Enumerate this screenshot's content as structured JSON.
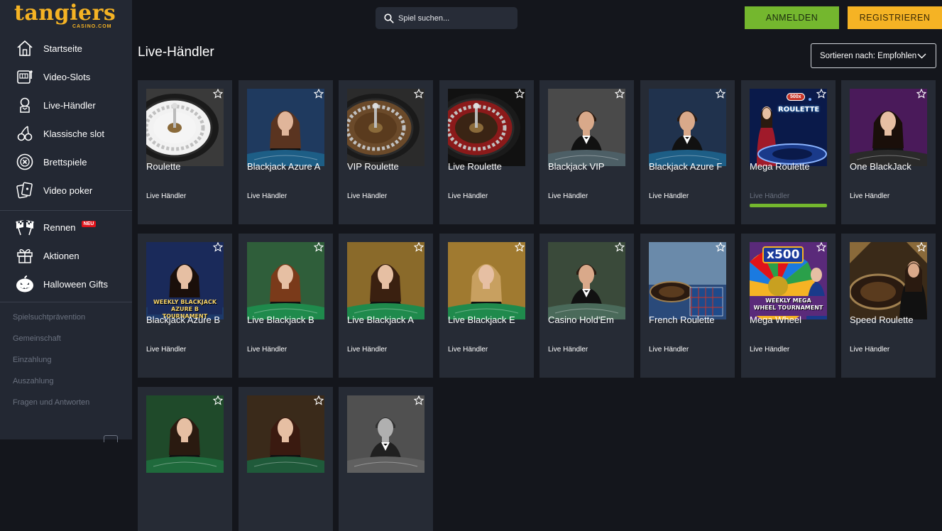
{
  "brand": {
    "name": "tangiers",
    "sub": "CASINO.COM"
  },
  "nav": [
    {
      "label": "Startseite",
      "icon": "home-icon"
    },
    {
      "label": "Video-Slots",
      "icon": "slot-machine-icon"
    },
    {
      "label": "Live-Händler",
      "icon": "dealer-icon"
    },
    {
      "label": "Klassische slot",
      "icon": "cherries-icon"
    },
    {
      "label": "Brettspiele",
      "icon": "chip-icon"
    },
    {
      "label": "Video poker",
      "icon": "cards-icon"
    }
  ],
  "nav2": [
    {
      "label": "Rennen",
      "icon": "race-flags-icon",
      "badge": "NEU"
    },
    {
      "label": "Aktionen",
      "icon": "gift-icon"
    },
    {
      "label": "Halloween Gifts",
      "icon": "pumpkin-icon"
    }
  ],
  "footer_links": [
    "Spielsuchtprävention",
    "Gemeinschaft",
    "Einzahlung",
    "Auszahlung",
    "Fragen und Antworten"
  ],
  "search": {
    "placeholder": "Spiel suchen..."
  },
  "header": {
    "login": "ANMELDEN",
    "register": "REGISTRIEREN"
  },
  "page": {
    "title": "Live-Händler",
    "sort_label": "Sortieren nach: Empfohlen"
  },
  "games": [
    {
      "title": "Roulette",
      "category": "Live Händler",
      "thumb": "roulette-wheel"
    },
    {
      "title": "Blackjack Azure A",
      "category": "Live Händler",
      "thumb": "dealer-blue"
    },
    {
      "title": "VIP Roulette",
      "category": "Live Händler",
      "thumb": "roulette-wheel-dark"
    },
    {
      "title": "Live Roulette",
      "category": "Live Händler",
      "thumb": "roulette-wheel-red"
    },
    {
      "title": "Blackjack VIP",
      "category": "Live Händler",
      "thumb": "dealer-male-table"
    },
    {
      "title": "Blackjack Azure F",
      "category": "Live Händler",
      "thumb": "dealer-male-blue"
    },
    {
      "title": "Mega Roulette",
      "category": "Live Händler",
      "thumb": "mega-roulette",
      "progress": 1.0
    },
    {
      "title": "One BlackJack",
      "category": "Live Händler",
      "thumb": "dealer-purple"
    },
    {
      "title": "Blackjack Azure B",
      "category": "Live Händler",
      "thumb": "dealer-tournament",
      "thumb_text": [
        "WEEKLY BLACKJACK",
        "AZURE B TOURNAMENT"
      ]
    },
    {
      "title": "Live Blackjack B",
      "category": "Live Händler",
      "thumb": "dealer-green"
    },
    {
      "title": "Live Blackjack A",
      "category": "Live Händler",
      "thumb": "dealer-gold"
    },
    {
      "title": "Live Blackjack E",
      "category": "Live Händler",
      "thumb": "dealer-gold-2"
    },
    {
      "title": "Casino Hold'Em",
      "category": "Live Händler",
      "thumb": "dealer-holdem"
    },
    {
      "title": "French Roulette",
      "category": "Live Händler",
      "thumb": "french-roulette"
    },
    {
      "title": "Mega Wheel",
      "category": "Live Händler",
      "thumb": "mega-wheel",
      "thumb_text": [
        "x500",
        "WEEKLY MEGA",
        "WHEEL TOURNAMENT"
      ]
    },
    {
      "title": "Speed Roulette",
      "category": "Live Händler",
      "thumb": "speed-roulette"
    },
    {
      "title": "",
      "category": "",
      "thumb": "dealer-green-2"
    },
    {
      "title": "",
      "category": "",
      "thumb": "dealer-dark"
    },
    {
      "title": "",
      "category": "",
      "thumb": "dealer-grey"
    }
  ],
  "mega_roulette_badge": "500x",
  "mega_roulette_text": "ROULETTE",
  "colors": {
    "sidebar": "#232833",
    "background": "#14161c",
    "card": "#262b35",
    "accent_gold": "#f5b324",
    "accent_green": "#74b72e"
  }
}
